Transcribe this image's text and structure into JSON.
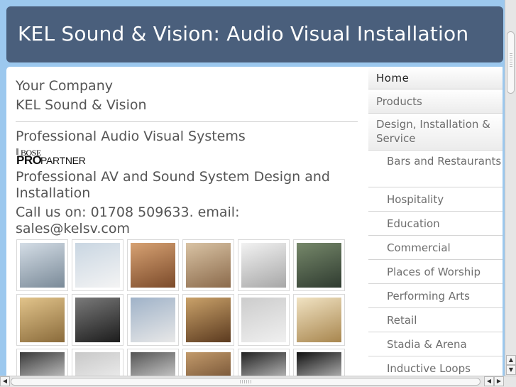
{
  "header": {
    "title": "KEL Sound & Vision: Audio Visual Installation"
  },
  "main": {
    "company_label": "Your Company",
    "company_name": "KEL Sound & Vision",
    "tagline": "Professional Audio Visual Systems",
    "logo": {
      "top": "BOSE",
      "pro": "PRO",
      "partner": "PARTNER"
    },
    "description": "Professional AV and Sound System Design and Installation",
    "contact": "Call us on: 01708 509633. email: sales@kelsv.com"
  },
  "thumbnails": [
    {
      "name": "control-room-photo",
      "colors": [
        "#7a8a98",
        "#d4dde6"
      ]
    },
    {
      "name": "wall-panel-photo",
      "colors": [
        "#f4f4f4",
        "#c9d6e2"
      ]
    },
    {
      "name": "restaurant-photo",
      "colors": [
        "#7b4a2a",
        "#d7a273"
      ]
    },
    {
      "name": "gallery-photo",
      "colors": [
        "#8b6a4b",
        "#d9c3a4"
      ]
    },
    {
      "name": "equipment-room-photo",
      "colors": [
        "#a7a7a7",
        "#f2f2f2"
      ]
    },
    {
      "name": "auditorium-photo",
      "colors": [
        "#2f3b30",
        "#76886a"
      ]
    },
    {
      "name": "church-interior-photo",
      "colors": [
        "#8a6b3b",
        "#e2c48b"
      ]
    },
    {
      "name": "speaker-photo",
      "colors": [
        "#1c1c1c",
        "#7a7a7a"
      ]
    },
    {
      "name": "volume-control-photo",
      "colors": [
        "#e8e8e8",
        "#9fb2c8"
      ]
    },
    {
      "name": "event-hall-photo",
      "colors": [
        "#5b3a1f",
        "#caa26a"
      ]
    },
    {
      "name": "wall-switch-photo",
      "colors": [
        "#f0f0f0",
        "#cccccc"
      ]
    },
    {
      "name": "lounge-photo",
      "colors": [
        "#a8864e",
        "#f1e3c3"
      ]
    },
    {
      "name": "amplifier-photo",
      "colors": [
        "#fafafa",
        "#3a3a3a"
      ]
    },
    {
      "name": "ceiling-speaker-photo",
      "colors": [
        "#fafafa",
        "#c8c8c8"
      ]
    },
    {
      "name": "device-photo",
      "colors": [
        "#fafafa",
        "#555555"
      ]
    },
    {
      "name": "cathedral-photo",
      "colors": [
        "#5a3a22",
        "#c29a6b"
      ]
    },
    {
      "name": "speaker-cluster-photo",
      "colors": [
        "#fafafa",
        "#222222"
      ]
    },
    {
      "name": "column-speaker-photo",
      "colors": [
        "#fafafa",
        "#111111"
      ]
    }
  ],
  "sidebar": {
    "items": [
      {
        "label": "Home",
        "kind": "home"
      },
      {
        "label": "Products",
        "kind": "top"
      },
      {
        "label": "Design, Installation & Service",
        "kind": "open"
      },
      {
        "label": "Bars and Restaurants",
        "kind": "sub"
      },
      {
        "label": "Hospitality",
        "kind": "sub"
      },
      {
        "label": "Education",
        "kind": "sub"
      },
      {
        "label": "Commercial",
        "kind": "sub"
      },
      {
        "label": "Places of Worship",
        "kind": "sub"
      },
      {
        "label": "Performing Arts",
        "kind": "sub"
      },
      {
        "label": "Retail",
        "kind": "sub"
      },
      {
        "label": "Stadia & Arena",
        "kind": "sub"
      },
      {
        "label": "Inductive Loops",
        "kind": "sub"
      }
    ]
  },
  "scrollbars": {
    "up_arrow": "▲",
    "down_arrow": "▼",
    "left_arrow": "◀",
    "right_arrow": "▶"
  },
  "colors": {
    "background": "#9cc8ee",
    "header": "#4a5f7c",
    "text": "#555555"
  }
}
